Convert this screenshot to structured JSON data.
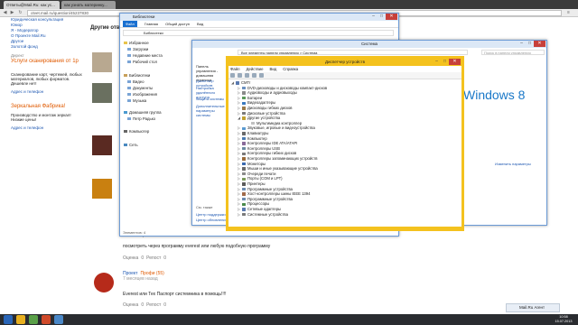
{
  "browser": {
    "tabs": [
      "Ответы@Mail.Ru: как ус...",
      "как узнать материнку..."
    ],
    "url": "otvet.mail.ru/question/45237830"
  },
  "sidebar": {
    "links_top": [
      "Юридическая консультация",
      "Юмор",
      "Я - Модератор",
      "О Проекте Mail.Ru",
      "Другое",
      "Золотой фонд"
    ],
    "ad1": {
      "label": "Директ",
      "title": "Услуги сканирования от 1р",
      "text": "Сканирование карт, чертежей, любых материалов, любых форматов. Дешевле нет!",
      "link": "Адрес и телефон"
    },
    "ad2": {
      "label": "",
      "title": "Зеркальная Фабрика!",
      "text": "Производство и монтаж зеркал! Низкие цены!",
      "link": "Адрес и телефон"
    }
  },
  "page": {
    "heading": "Другие отв...",
    "comment_count": "Комментарии: 4",
    "answer1": "посмотреть через программу everest или любую подобную программу",
    "votes1_label": "Оценка",
    "votes1_value": "0",
    "votes1_sep": "Репост",
    "votes1_value2": "0",
    "author2": "Проект",
    "author2_badge": "Профи (55)",
    "author2_meta": "7 месяцев назад",
    "answer2": "Everest или Тех Паспорт системника в помощь!!!!",
    "votes2_label": "Оценка",
    "votes2_value": "0",
    "votes2_sep": "Репост",
    "votes2_value2": "0",
    "more": "Ещё ответы"
  },
  "explorer": {
    "title": "Библиотеки",
    "ribbon": [
      "Файл",
      "Главная",
      "Общий доступ",
      "Вид"
    ],
    "path": "Библиотеки",
    "nav": [
      "Избранное",
      "Загрузки",
      "Недавние места",
      "Рабочий стол",
      "Библиотеки",
      "Видео",
      "Документы",
      "Изображения",
      "Музыка",
      "Домашняя группа",
      "Петр Радько",
      "Компьютер",
      "Сеть"
    ],
    "status": "Элементов: 4"
  },
  "system": {
    "title": "Система",
    "path": "Все элементы панели управления  >  Система",
    "search_placeholder": "Поиск в панели управления",
    "left_links": [
      "Панель управления - домашняя страница",
      "Диспетчер устройств",
      "Настройка удалённого доступа",
      "Защита системы",
      "Дополнительные параметры системы"
    ],
    "see_also": "См. также",
    "see_also_links": [
      "Центр поддержки",
      "Центр обновления Windows",
      "Счётчики и средства производительности"
    ],
    "brand": "Windows 8",
    "change_params": "Изменить параметры"
  },
  "devmgr": {
    "title": "Диспетчер устройств",
    "menu": [
      "Файл",
      "Действие",
      "Вид",
      "Справка"
    ],
    "root": "CMTr",
    "items": [
      "DVD-дисководы и дисководы компакт-дисков",
      "Аудиовходы и аудиовыходы",
      "Батареи",
      "Видеоадаптеры",
      "Дисководы гибких дисков",
      "Дисковые устройства",
      "Другие устройства",
      "Мультимедиа контроллер",
      "Звуковые, игровые и видеоустройства",
      "Клавиатуры",
      "Компьютер",
      "Контроллеры IDE ATA/ATAPI",
      "Контроллеры USB",
      "Контроллеры гибких дисков",
      "Контроллеры запоминающих устройств",
      "Мониторы",
      "Мыши и иные указывающие устройства",
      "Очереди печати",
      "Порты (COM и LPT)",
      "Принтеры",
      "Программные устройства",
      "Хост-контроллеры шины IEEE 1394",
      "Программные устройства",
      "Процессоры",
      "Сетевые адаптеры",
      "Системные устройства"
    ]
  },
  "chat": {
    "label": "Mail.Ru Агент"
  },
  "clock": {
    "time": "10:58",
    "date": "15.07.2013"
  },
  "colors": {
    "accent": "#f4c21e",
    "link": "#1a55b0",
    "win8": "#1a78c8"
  }
}
